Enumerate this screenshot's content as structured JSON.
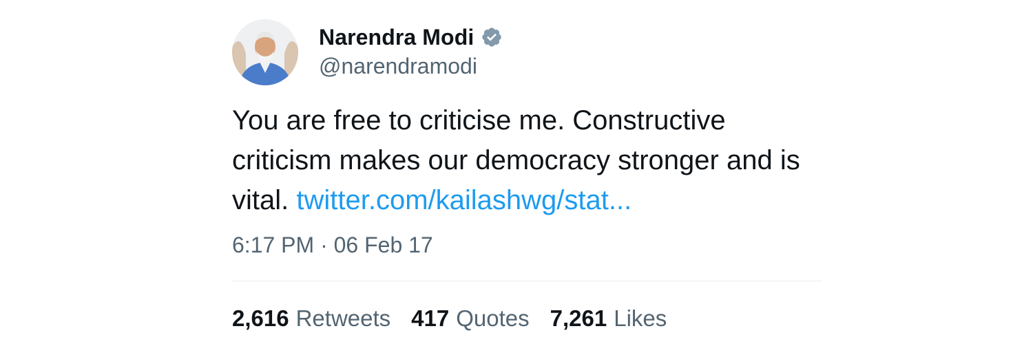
{
  "author": {
    "display_name": "Narendra Modi",
    "handle": "@narendramodi",
    "verified_badge_icon": "verified-badge-icon",
    "verified_color": "#829aab"
  },
  "tweet": {
    "text": "You are free to criticise me. Constructive criticism makes our democracy stronger and is vital.",
    "link_text": "twitter.com/kailashwg/stat...",
    "link_color": "#1d9bf0",
    "time": "6:17 PM",
    "separator": "·",
    "date": "06 Feb 17"
  },
  "stats": {
    "retweets_count": "2,616",
    "retweets_label": "Retweets",
    "quotes_count": "417",
    "quotes_label": "Quotes",
    "likes_count": "7,261",
    "likes_label": "Likes"
  }
}
